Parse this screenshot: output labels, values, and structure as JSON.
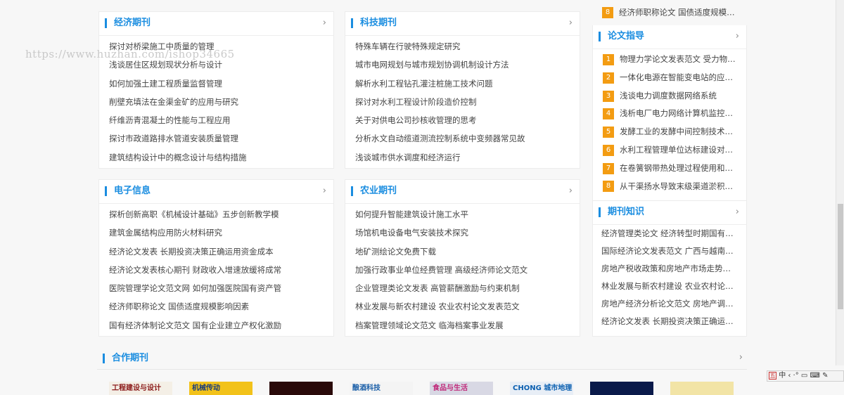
{
  "watermark": "https://www.huzhan.com/ishop34665",
  "top_right_item": {
    "num": "8",
    "text": "经济师职称论文 国债适度规模…"
  },
  "cards": {
    "economy": {
      "title": "经济期刊",
      "more": "›",
      "items": [
        "探讨对桥梁施工中质量的管理",
        "浅谈居住区规划现状分析与设计",
        "如何加强土建工程质量监督管理",
        "削壁充填法在金渠金矿的应用与研究",
        "纤维沥青混凝土的性能与工程应用",
        "探讨市政道路排水管道安装质量管理",
        "建筑结构设计中的概念设计与结构措施"
      ]
    },
    "tech": {
      "title": "科技期刊",
      "more": "›",
      "items": [
        "特殊车辆在行驶特殊规定研究",
        "城市电网规划与城市规划协调机制设计方法",
        "解析水利工程钻孔灌注桩施工技术问题",
        "探讨对水利工程设计阶段造价控制",
        "关于对供电公司抄核收管理的思考",
        "分析水文自动缆道测流控制系统中变频器常见故",
        "浅谈城市供水调度和经济运行"
      ]
    },
    "electronic": {
      "title": "电子信息",
      "more": "›",
      "items": [
        "探析创新高职《机械设计基础》五步创新教学模",
        "建筑金属结构应用防火材料研究",
        "经济论文发表 长期投资决策正确运用资金成本",
        "经济论文发表核心期刊 财政收入增速放缓将成常",
        "医院管理学论文范文网 如何加强医院国有资产管",
        "经济师职称论文 国债适度规模影响因素",
        "国有经济体制论文范文 国有企业建立产权化激励"
      ]
    },
    "agriculture": {
      "title": "农业期刊",
      "more": "›",
      "items": [
        "如何提升智能建筑设计施工水平",
        "场馆机电设备电气安装技术探究",
        "地矿测绘论文免费下载",
        "加强行政事业单位经费管理 高级经济师论文范文",
        "企业管理类论文发表 高管薪酬激励与约束机制",
        "林业发展与新农村建设 农业农村论文发表范文",
        "档案管理领域论文范文 临海档案事业发展"
      ]
    },
    "guide": {
      "title": "论文指导",
      "more": "›",
      "items": [
        {
          "num": "1",
          "text": "物理力学论文发表范文 受力物…"
        },
        {
          "num": "2",
          "text": "一体化电源在智能变电站的应…"
        },
        {
          "num": "3",
          "text": "浅谈电力调度数据网络系统"
        },
        {
          "num": "4",
          "text": "浅析电厂电力网络计算机监控…"
        },
        {
          "num": "5",
          "text": "发酵工业的发酵中间控制技术…"
        },
        {
          "num": "6",
          "text": "水利工程管理单位达标建设对…"
        },
        {
          "num": "7",
          "text": "在卷簧钢带热处理过程使用和…"
        },
        {
          "num": "8",
          "text": "从干渠扬水导致末级渠道淤积…"
        }
      ]
    },
    "knowledge": {
      "title": "期刊知识",
      "more": "›",
      "items": [
        "经济管理类论文 经济转型时期国有…",
        "国际经济论文发表范文 广西与越南…",
        "房地产税收政策和房地产市场走势…",
        "林业发展与新农村建设 农业农村论…",
        "房地产经济分析论文范文 房地产调…",
        "经济论文发表 长期投资决策正确运…"
      ]
    }
  },
  "coop": {
    "title": "合作期刊",
    "more": "›",
    "covers": [
      {
        "label": "工程建设与设计",
        "color": "#8b1a1a"
      },
      {
        "label": "机械传动",
        "color": "#1b3d7a"
      },
      {
        "label": "",
        "color": "#2a0a0a"
      },
      {
        "label": "酿酒科技",
        "color": "#1b5fa8"
      },
      {
        "label": "食品与生活",
        "color": "#c02a7a"
      },
      {
        "label": "CHONG 城市地理",
        "color": "#0a5fb0"
      },
      {
        "label": "",
        "color": "#0a1a4a"
      },
      {
        "label": "",
        "color": "#3a7ac0"
      }
    ]
  },
  "ime": {
    "text": "中 ‹ ·° ▭ ⌨ ✎"
  }
}
